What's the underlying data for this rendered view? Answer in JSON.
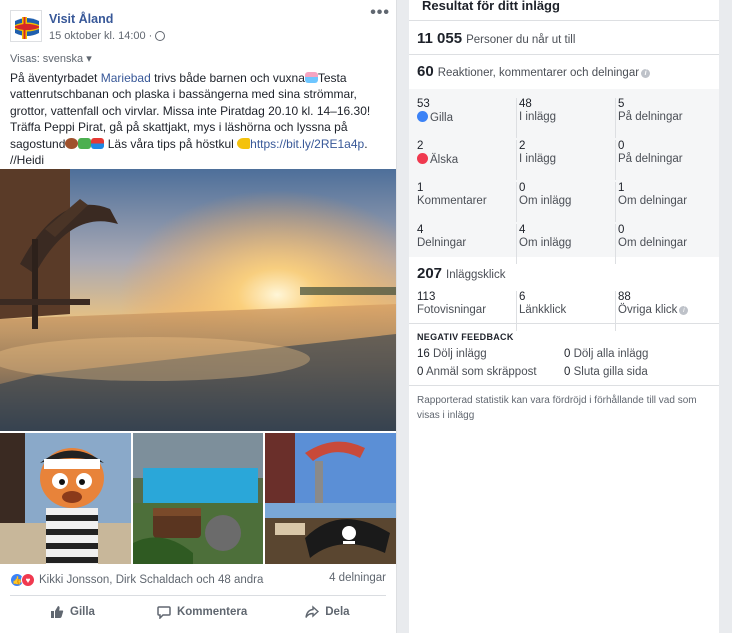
{
  "post": {
    "page_name": "Visit Åland",
    "timestamp": "15 oktober kl. 14:00 ·",
    "visible_to": "Visas: svenska ▾",
    "more_icon": "ellipsis-icon",
    "text_part1": "På äventyrbadet ",
    "text_link1": "Mariebad",
    "text_part2": " trivs både barnen och vuxna",
    "text_part3": "Testa vattenrutschbanan och plaska i bassängerna med sina strömmar, grottor, vattenfall och virvlar. Missa inte Piratdag 20.10 kl. 14–16.30! Träffa Peppi Pirat, gå på skattjakt, mys i läshörna och lyssna på sagostund",
    "text_part4": " Läs våra tips på höstkul ",
    "text_link2": "https://bit.ly/2RE1a4p",
    "text_part5": ".",
    "text_sign": "//Heidi",
    "reactions_summary": "Kikki Jonsson, Dirk Schaldach och 48 andra",
    "shares_label": "4 delningar",
    "actions": {
      "like": "Gilla",
      "comment": "Kommentera",
      "share": "Dela"
    }
  },
  "stats": {
    "title": "Resultat för ditt inlägg",
    "reach_num": "11 055",
    "reach_label": "Personer du når ut till",
    "engagement_num": "60",
    "engagement_label": "Reaktioner, kommentarer och delningar",
    "grid": [
      [
        {
          "num": "53",
          "label": "Gilla"
        },
        {
          "num": "48",
          "label": "I inlägg"
        },
        {
          "num": "5",
          "label": "På delningar"
        }
      ],
      [
        {
          "num": "2",
          "label": "Älska"
        },
        {
          "num": "2",
          "label": "I inlägg"
        },
        {
          "num": "0",
          "label": "På delningar"
        }
      ],
      [
        {
          "num": "1",
          "label": "Kommentarer"
        },
        {
          "num": "0",
          "label": "Om inlägg"
        },
        {
          "num": "1",
          "label": "Om delningar"
        }
      ],
      [
        {
          "num": "4",
          "label": "Delningar"
        },
        {
          "num": "4",
          "label": "Om inlägg"
        },
        {
          "num": "0",
          "label": "Om delningar"
        }
      ]
    ],
    "clicks_num": "207",
    "clicks_label": "Inläggsklick",
    "clicks": [
      {
        "num": "113",
        "label": "Fotovisningar"
      },
      {
        "num": "6",
        "label": "Länkklick"
      },
      {
        "num": "88",
        "label": "Övriga klick"
      }
    ],
    "neg_title": "NEGATIV FEEDBACK",
    "neg": [
      {
        "num": "16",
        "label": "Dölj inlägg"
      },
      {
        "num": "0",
        "label": "Dölj alla inlägg"
      },
      {
        "num": "0",
        "label": "Anmäl som skräppost"
      },
      {
        "num": "0",
        "label": "Sluta gilla sida"
      }
    ],
    "note": "Rapporterad statistik kan vara fördröjd i förhållande till vad som visas i inlägg"
  },
  "colors": {
    "link": "#385898",
    "like": "#3b82f6",
    "love": "#f0394f"
  }
}
